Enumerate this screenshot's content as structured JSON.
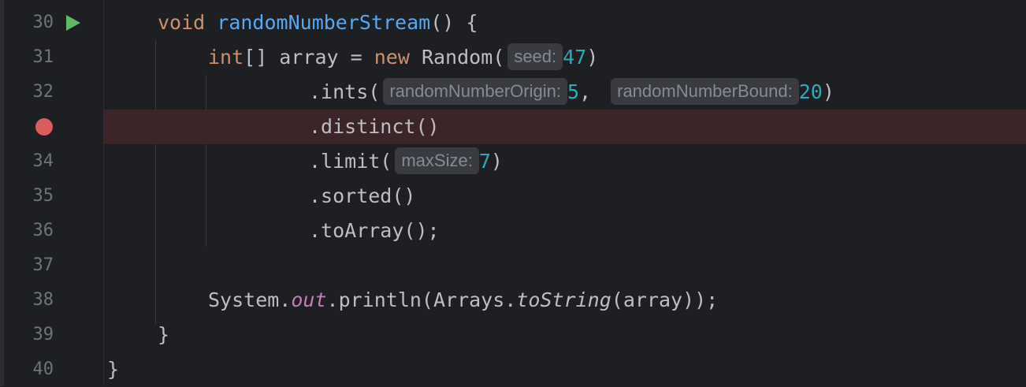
{
  "editor": {
    "lines": [
      {
        "num": "30",
        "tokens": {
          "t1": "void",
          "t2": "randomNumberStream",
          "t3": "() {"
        }
      },
      {
        "num": "31",
        "tokens": {
          "t1": "int",
          "t2": "[] array = ",
          "t3": "new",
          "t4": " Random(",
          "hint": "seed:",
          "t5": "47",
          "t6": ")"
        }
      },
      {
        "num": "32",
        "tokens": {
          "t1": ".ints(",
          "hint1": "randomNumberOrigin:",
          "t2": "5",
          "t3": ", ",
          "hint2": "randomNumberBound:",
          "t4": "20",
          "t5": ")"
        }
      },
      {
        "num": "33",
        "tokens": {
          "t1": ".distinct()"
        }
      },
      {
        "num": "34",
        "tokens": {
          "t1": ".limit(",
          "hint": "maxSize:",
          "t2": "7",
          "t3": ")"
        }
      },
      {
        "num": "35",
        "tokens": {
          "t1": ".sorted()"
        }
      },
      {
        "num": "36",
        "tokens": {
          "t1": ".toArray();"
        }
      },
      {
        "num": "37",
        "tokens": {}
      },
      {
        "num": "38",
        "tokens": {
          "t1": "System.",
          "t2": "out",
          "t3": ".println(Arrays.",
          "t4": "toString",
          "t5": "(array));"
        }
      },
      {
        "num": "39",
        "tokens": {
          "t1": "}"
        }
      },
      {
        "num": "40",
        "tokens": {
          "t1": "}"
        }
      }
    ],
    "breakpoint_line": "33",
    "run_gutter_line": "30",
    "colors": {
      "background": "#1e1f22",
      "keyword": "#cf8e6d",
      "function": "#56a8f5",
      "number": "#2aacb8",
      "static_field": "#c77dbb",
      "breakpoint": "#db5c5c",
      "breakpoint_line_bg": "#3c2528",
      "run_icon": "#5fb865"
    },
    "icons": {
      "run": "run-gutter-icon",
      "breakpoint": "breakpoint-icon"
    }
  }
}
